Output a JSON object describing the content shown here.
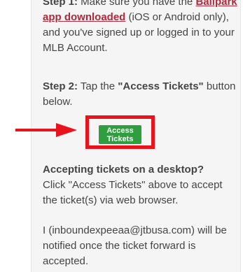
{
  "colors": {
    "panel_background": "#f5f5f5",
    "text": "#444444",
    "link": "#b0283a",
    "button_background": "#2f9e3f",
    "button_text": "#ffffff",
    "highlight": "#e8141b",
    "arrow": "#e8141b"
  },
  "icons": {
    "arrow": "right-arrow-icon"
  },
  "step1": {
    "label": "Step 1:",
    "text_before": " Make sure you have the ",
    "link": "Ballpark app downloaded",
    "text_after": " (iOS or Android only), and you've signed up or logged in to your MLB Account."
  },
  "step2": {
    "label": "Step 2:",
    "text_before": " Tap the ",
    "button_name": "\"Access Tickets\"",
    "text_after": " button below."
  },
  "button": {
    "label": "Access Tickets"
  },
  "desktop": {
    "heading": "Accepting tickets on a desktop?",
    "text": "Click \"Access Tickets\" above to accept the ticket(s) via web browser."
  },
  "notification": {
    "text": "I (inboundexpeeaa@jtbusa.com) will be notified once the ticket forward is accepted."
  }
}
